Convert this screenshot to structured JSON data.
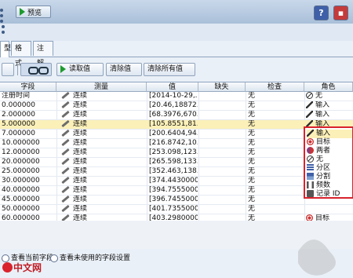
{
  "toolbar_top": {
    "preview_label": "预览"
  },
  "tabs": [
    {
      "label": "型"
    },
    {
      "label": "格式"
    },
    {
      "label": "注解"
    }
  ],
  "actions": {
    "read_values": "读取值",
    "clear_values": "清除值",
    "clear_all_values": "清除所有值"
  },
  "columns": [
    "字段",
    "测量",
    "值",
    "缺失",
    "检查",
    "角色"
  ],
  "rows": [
    {
      "field": "注册时间",
      "measure": "连续",
      "value": "[2014-10-29,...",
      "missing": "",
      "check": "无",
      "role": "无",
      "role_icon": "none-icon"
    },
    {
      "field": "0.000000",
      "measure": "连续",
      "value": "[20.46,18872....",
      "missing": "",
      "check": "无",
      "role": "输入",
      "role_icon": "input-icon"
    },
    {
      "field": "2.000000",
      "measure": "连续",
      "value": "[68.3976,670....",
      "missing": "",
      "check": "无",
      "role": "输入",
      "role_icon": "input-icon"
    },
    {
      "field": "5.000000",
      "measure": "连续",
      "value": "[105.8551,81...",
      "missing": "",
      "check": "无",
      "role": "输入",
      "role_icon": "input-icon"
    },
    {
      "field": "7.000000",
      "measure": "连续",
      "value": "[200.6404,94...",
      "missing": "",
      "check": "无",
      "role": "",
      "role_icon": ""
    },
    {
      "field": "10.000000",
      "measure": "连续",
      "value": "[216.8742,10...",
      "missing": "",
      "check": "无",
      "role": "",
      "role_icon": ""
    },
    {
      "field": "12.000000",
      "measure": "连续",
      "value": "[253.098,123....",
      "missing": "",
      "check": "无",
      "role": "",
      "role_icon": ""
    },
    {
      "field": "20.000000",
      "measure": "连续",
      "value": "[265.598,133....",
      "missing": "",
      "check": "无",
      "role": "",
      "role_icon": ""
    },
    {
      "field": "25.000000",
      "measure": "连续",
      "value": "[352.463,138....",
      "missing": "",
      "check": "无",
      "role": "",
      "role_icon": ""
    },
    {
      "field": "30.000000",
      "measure": "连续",
      "value": "[374.4430000...",
      "missing": "",
      "check": "无",
      "role": "",
      "role_icon": ""
    },
    {
      "field": "40.000000",
      "measure": "连续",
      "value": "[394.7555000...",
      "missing": "",
      "check": "无",
      "role": "",
      "role_icon": ""
    },
    {
      "field": "45.000000",
      "measure": "连续",
      "value": "[396.7455000...",
      "missing": "",
      "check": "无",
      "role": "",
      "role_icon": ""
    },
    {
      "field": "50.000000",
      "measure": "连续",
      "value": "[401.7355000...",
      "missing": "",
      "check": "无",
      "role": "",
      "role_icon": ""
    },
    {
      "field": "60.000000",
      "measure": "连续",
      "value": "[403.2980000...",
      "missing": "",
      "check": "无",
      "role": "目标",
      "role_icon": "target-icon"
    }
  ],
  "role_dropdown": [
    {
      "label": "输入",
      "icon": "input-icon"
    },
    {
      "label": "目标",
      "icon": "target-icon"
    },
    {
      "label": "两者",
      "icon": "both-icon"
    },
    {
      "label": "无",
      "icon": "none-icon"
    },
    {
      "label": "分区",
      "icon": "partition-icon"
    },
    {
      "label": "分割",
      "icon": "split-icon"
    },
    {
      "label": "频数",
      "icon": "frequency-icon"
    },
    {
      "label": "记录 ID",
      "icon": "record-id-icon"
    }
  ],
  "bottom": {
    "opt1": "查看当前字段",
    "opt2": "查看未使用的字段设置"
  },
  "logo": {
    "text": "中文网"
  },
  "colors": {
    "selected_row": "#fbf0b8",
    "dropdown_border": "#d9232d",
    "preview_icon": "#1d9a2e"
  }
}
